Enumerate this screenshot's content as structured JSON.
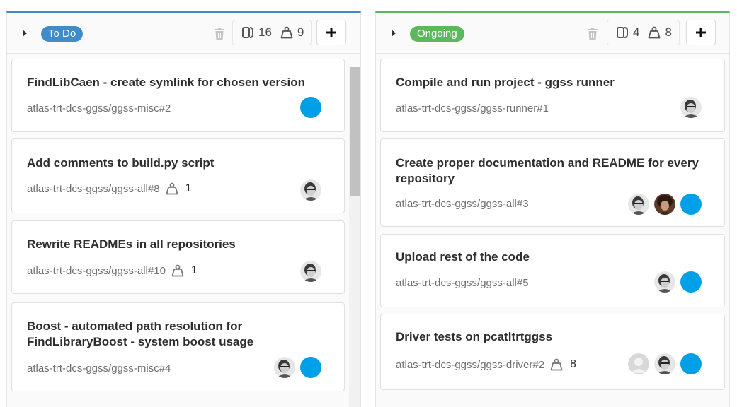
{
  "boards": [
    {
      "label": "To Do",
      "issue_count": "16",
      "weight_total": "9",
      "add_label": "+",
      "cards": [
        {
          "title": "FindLibCaen - create symlink for chosen version",
          "ref": "atlas-trt-dcs-ggss/ggss-misc#2",
          "weight": "",
          "assignees": [
            "blue"
          ]
        },
        {
          "title": "Add comments to build.py script",
          "ref": "atlas-trt-dcs-ggss/ggss-all#8",
          "weight": "1",
          "assignees": [
            "photo-a"
          ]
        },
        {
          "title": "Rewrite READMEs in all repositories",
          "ref": "atlas-trt-dcs-ggss/ggss-all#10",
          "weight": "1",
          "assignees": [
            "photo-a"
          ]
        },
        {
          "title": "Boost - automated path resolution for FindLibraryBoost - system boost usage",
          "ref": "atlas-trt-dcs-ggss/ggss-misc#4",
          "weight": "",
          "assignees": [
            "photo-a",
            "blue"
          ]
        }
      ]
    },
    {
      "label": "Ongoing",
      "issue_count": "4",
      "weight_total": "8",
      "add_label": "+",
      "cards": [
        {
          "title": "Compile and run project - ggss runner",
          "ref": "atlas-trt-dcs-ggss/ggss-runner#1",
          "weight": "",
          "assignees": [
            "photo-a"
          ]
        },
        {
          "title": "Create proper documentation and README for every repository",
          "ref": "atlas-trt-dcs-ggss/ggss-all#3",
          "weight": "",
          "assignees": [
            "photo-a",
            "photo-b",
            "blue"
          ]
        },
        {
          "title": "Upload rest of the code",
          "ref": "atlas-trt-dcs-ggss/ggss-all#5",
          "weight": "",
          "assignees": [
            "photo-a",
            "blue"
          ]
        },
        {
          "title": "Driver tests on pcatltrtggss",
          "ref": "atlas-trt-dcs-ggss/ggss-driver#2",
          "weight": "8",
          "assignees": [
            "default",
            "photo-a",
            "blue"
          ]
        }
      ]
    }
  ],
  "icons": {
    "collapse": "caret-right-icon",
    "delete": "trash-icon",
    "issues": "issues-icon",
    "weight": "weight-icon",
    "add": "plus-icon"
  },
  "colors": {
    "todo": "#428bca",
    "ongoing": "#5cb85c",
    "assignee_blue": "#00a0e8"
  }
}
